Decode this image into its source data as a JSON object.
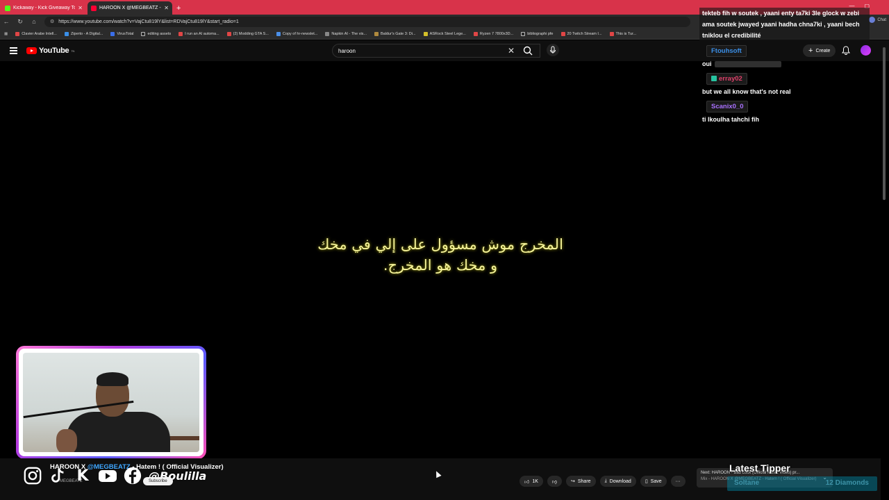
{
  "browser": {
    "tabs": [
      {
        "title": "Kickaway - Kick Giveaway Tool",
        "active": false,
        "favicon_color": "#53fc18"
      },
      {
        "title": "HAROON X @MEGBEATZ - Hatem",
        "active": true,
        "favicon_color": "#ff0033"
      }
    ],
    "new_tab": "+",
    "url": "https://www.youtube.com/watch?v=VajCtu819lY&list=RDVajCtu819lY&start_radio=1",
    "extension_label": "Chat",
    "bookmarks": [
      "Clavier Arabe Intell...",
      "Ziperto - A Digital...",
      "VirusTotal",
      "editing assets",
      "I run an AI automa...",
      "(2) Modding GTA S...",
      "Copy of hr-newslet...",
      "Napkin AI - The vis...",
      "Baldur's Gate 3: Di...",
      "ASRock Steel Lege...",
      "Ryzen 7 7800x3D...",
      "bibliographi pfe",
      "20 Twitch Stream I...",
      "This is Tur..."
    ]
  },
  "youtube": {
    "logo": "YouTube",
    "logo_suffix": "TN",
    "search_value": "haroon",
    "create_label": "Create"
  },
  "video": {
    "subtitle_line1": "المخرج موش مسؤول على إلي في مخك",
    "subtitle_line2": "و مخك هو المخرج.",
    "title_prefix": "HAROON X ",
    "title_handle": "@MEGBEATZ",
    "title_suffix": " - Hatem ! ( Official Visualizer)",
    "channel_sub": "MEGBEATZ",
    "subscribe_label": "Subscribe",
    "like_count": "1K",
    "share_label": "Share",
    "download_label": "Download",
    "save_label": "Save",
    "more_label": "···"
  },
  "chat": {
    "top_message": "tekteb fih w soutek , yaani enty ta7ki 3le glock w zebi ama soutek jwayed yaani hadha chna7ki , yaani bech tniklou el credibilité",
    "messages": [
      {
        "user": "Ftouhsoft",
        "color": "#3a8fe8",
        "text": "oui",
        "badge": false
      },
      {
        "user": "erray02",
        "color": "#e0406a",
        "text": "but we all know that's not real",
        "badge": true
      },
      {
        "user": "Scanix0_0",
        "color": "#a970ff",
        "text": "ti lkoulha tahchi fih",
        "badge": false
      }
    ]
  },
  "overlay": {
    "social_handle": "@Boulilla",
    "latest_tipper_title": "Latest Tipper",
    "tipper_name": "Soltane",
    "tipper_amount": "12 Diamonds"
  },
  "up_next": {
    "line1": "Next: HAROON - Bad Luck (Official Music Video) pr...",
    "line2": "Mix - HAROON X @MEGBEATZ - Hatem ! ( Official Visualizer)"
  }
}
